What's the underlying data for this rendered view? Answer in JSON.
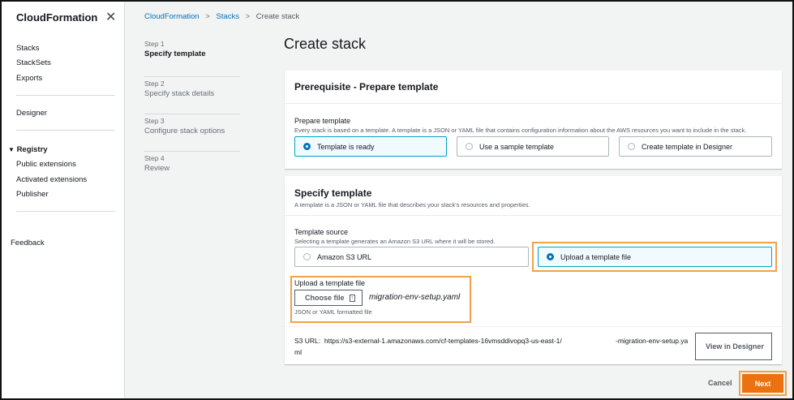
{
  "sidebar": {
    "title": "CloudFormation",
    "items": [
      "Stacks",
      "StackSets",
      "Exports"
    ],
    "designer": "Designer",
    "registry": "Registry",
    "registry_items": [
      "Public extensions",
      "Activated extensions",
      "Publisher"
    ],
    "feedback": "Feedback"
  },
  "breadcrumb": {
    "items": [
      "CloudFormation",
      "Stacks",
      "Create stack"
    ]
  },
  "steps": [
    {
      "n": "Step 1",
      "label": "Specify template"
    },
    {
      "n": "Step 2",
      "label": "Specify stack details"
    },
    {
      "n": "Step 3",
      "label": "Configure stack options"
    },
    {
      "n": "Step 4",
      "label": "Review"
    }
  ],
  "page_title": "Create stack",
  "prereq": {
    "header": "Prerequisite - Prepare template",
    "label": "Prepare template",
    "desc": "Every stack is based on a template. A template is a JSON or YAML file that contains configuration information about the AWS resources you want to include in the stack.",
    "options": [
      "Template is ready",
      "Use a sample template",
      "Create template in Designer"
    ],
    "selected": 0
  },
  "specify": {
    "header": "Specify template",
    "desc": "A template is a JSON or YAML file that describes your stack's resources and properties.",
    "source_label": "Template source",
    "source_desc": "Selecting a template generates an Amazon S3 URL where it will be stored.",
    "options": [
      "Amazon S3 URL",
      "Upload a template file"
    ],
    "selected": 1,
    "upload_label": "Upload a template file",
    "choose_file": "Choose file",
    "file_name": "migration-env-setup.yaml",
    "upload_hint": "JSON or YAML formatted file",
    "s3_label": "S3 URL:",
    "s3_url_1": "https://s3-external-1.amazonaws.com/cf-templates-16vmsddivopq3-us-east-1/",
    "s3_url_2": "-migration-env-setup.ya",
    "s3_url_3": "ml",
    "view_designer": "View in Designer"
  },
  "footer": {
    "cancel": "Cancel",
    "next": "Next"
  },
  "colors": {
    "accent": "#ec7211",
    "highlight": "#f0a14a",
    "link": "#0073bb"
  }
}
